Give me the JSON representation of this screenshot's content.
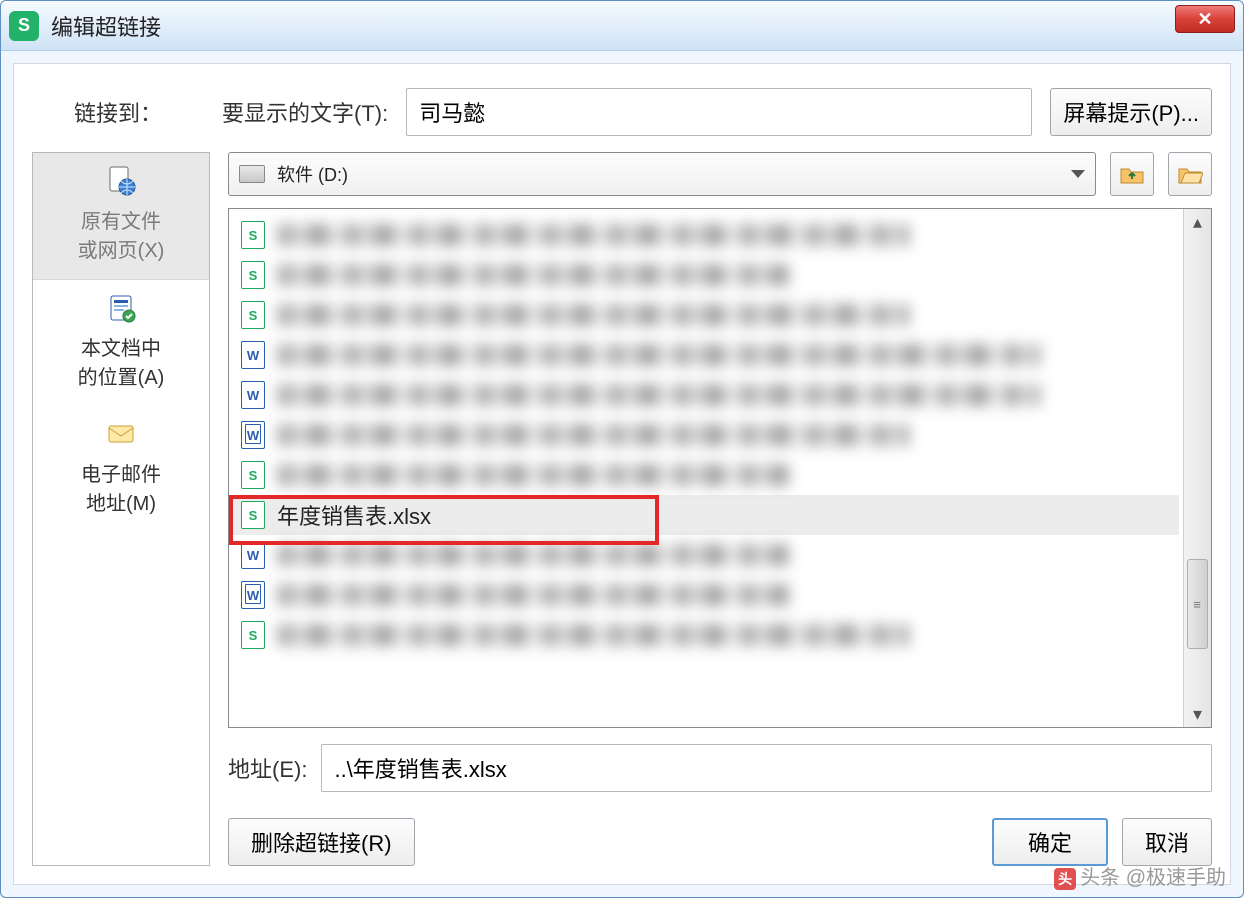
{
  "window": {
    "title": "编辑超链接",
    "close_glyph": "✕"
  },
  "top": {
    "linkto_label": "链接到：",
    "display_text_label": "要显示的文字(T):",
    "display_text_value": "司马懿",
    "screentip_btn": "屏幕提示(P)..."
  },
  "linkto_panel": {
    "items": [
      {
        "label_line1": "原有文件",
        "label_line2": "或网页(X)",
        "key": "existing",
        "selected": true
      },
      {
        "label_line1": "本文档中",
        "label_line2": "的位置(A)",
        "key": "place",
        "selected": false
      },
      {
        "label_line1": "电子邮件",
        "label_line2": "地址(M)",
        "key": "email",
        "selected": false
      }
    ]
  },
  "lookin": {
    "combo_text": "软件 (D:)",
    "up_tooltip": "up-one-level",
    "browse_tooltip": "browse"
  },
  "file_list": {
    "selected_index": 7,
    "items": [
      {
        "icon": "s",
        "name": "",
        "blurred": true,
        "len": "mid"
      },
      {
        "icon": "s",
        "name": "",
        "blurred": true,
        "len": "short"
      },
      {
        "icon": "s",
        "name": "",
        "blurred": true,
        "len": "mid"
      },
      {
        "icon": "w",
        "name": "",
        "blurred": true,
        "len": "long"
      },
      {
        "icon": "w",
        "name": "",
        "blurred": true,
        "len": "long"
      },
      {
        "icon": "wo",
        "name": "",
        "blurred": true,
        "len": "mid"
      },
      {
        "icon": "s",
        "name": "",
        "blurred": true,
        "len": "short"
      },
      {
        "icon": "s",
        "name": "年度销售表.xlsx",
        "blurred": false
      },
      {
        "icon": "w",
        "name": "",
        "blurred": true,
        "len": "short"
      },
      {
        "icon": "wo",
        "name": "",
        "blurred": true,
        "len": "short"
      },
      {
        "icon": "s",
        "name": "",
        "blurred": true,
        "len": "mid"
      }
    ]
  },
  "address": {
    "label": "地址(E):",
    "value": "..\\年度销售表.xlsx"
  },
  "buttons": {
    "remove": "删除超链接(R)",
    "ok": "确定",
    "cancel": "取消"
  },
  "watermark": "头条 @极速手助"
}
